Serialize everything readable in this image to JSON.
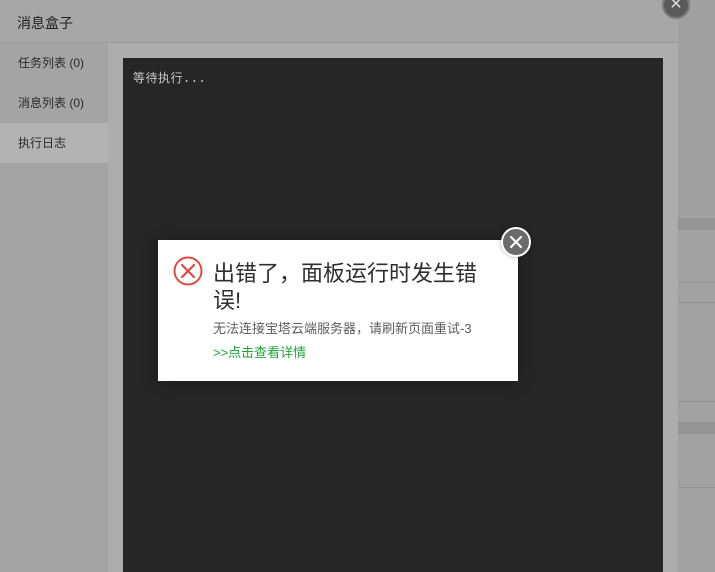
{
  "message_box": {
    "title": "消息盒子",
    "sidebar": [
      {
        "label": "任务列表 (0)",
        "active": false
      },
      {
        "label": "消息列表 (0)",
        "active": false
      },
      {
        "label": "执行日志",
        "active": true
      }
    ],
    "console_text": "等待执行..."
  },
  "error_dialog": {
    "title": "出错了，面板运行时发生错误!",
    "message": "无法连接宝塔云端服务器，请刷新页面重试-3",
    "link": ">>点击查看详情"
  },
  "colors": {
    "error_red": "#e04a3f",
    "link_green": "#20a53a",
    "console_bg": "#262626"
  }
}
